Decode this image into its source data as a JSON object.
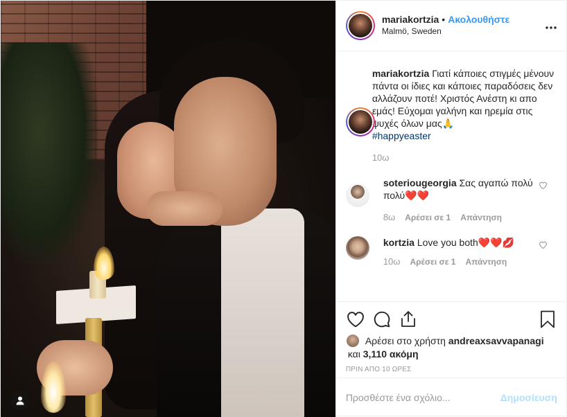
{
  "post": {
    "author": {
      "username": "mariakortzia",
      "separator": "•",
      "follow_label": "Ακολουθήστε",
      "location": "Malmö, Sweden",
      "more_icon": "more-horizontal-icon"
    },
    "caption": {
      "username": "mariakortzia",
      "text": "Γιατί κάποιες στιγμές μένουν πάντα οι ίδιες και κάποιες παραδόσεις δεν αλλάζουν ποτέ! Χριστός Ανέστη κι απο εμάς! Εύχομαι γαλήνη και ηρεμία στις ψυχές όλων μας🙏",
      "hashtag": "#happyeaster",
      "time": "10ω"
    },
    "comments": [
      {
        "username": "soteriougeorgia",
        "text": "Σας αγαπώ πολύ πολύ❤️❤️",
        "time": "8ω",
        "likes": "Αρέσει σε 1",
        "reply": "Απάντηση"
      },
      {
        "username": "kortzia",
        "text": "Love you both❤️❤️💋",
        "time": "10ω",
        "likes": "Αρέσει σε 1",
        "reply": "Απάντηση"
      }
    ],
    "likes": {
      "prefix": "Αρέσει στο χρήστη",
      "user": "andreaxsavvapanagi",
      "connector": "και",
      "count": "3,110 ακόμη"
    },
    "time_ago": "ΠΡΙΝ ΑΠΟ 10 ΩΡΕΣ",
    "add_comment": {
      "placeholder": "Προσθέστε ένα σχόλιο...",
      "post_label": "Δημοσίευση"
    },
    "colors": {
      "accent": "#3897f0",
      "post_disabled": "#b2dffc",
      "muted": "#999999"
    }
  }
}
